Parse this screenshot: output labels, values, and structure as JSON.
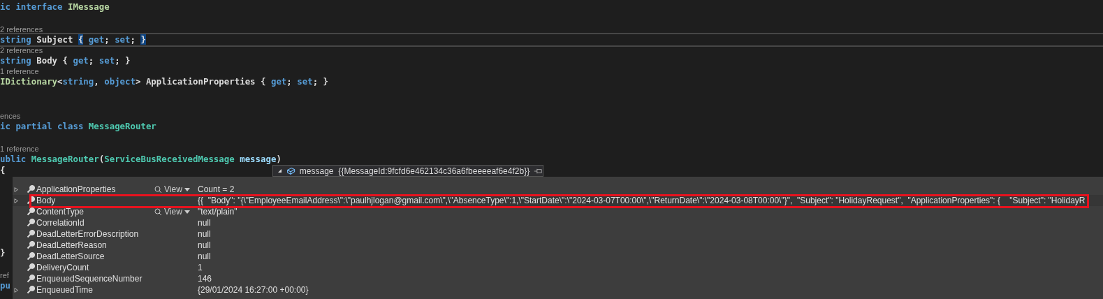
{
  "code_lines": [
    {
      "kind": "code",
      "current": false,
      "tokens": [
        {
          "text": "ic ",
          "kind": "keyword"
        },
        {
          "text": "interface ",
          "kind": "keyword"
        },
        {
          "text": "IMessage",
          "kind": "interface"
        }
      ]
    },
    {
      "kind": "blank"
    },
    {
      "kind": "lens",
      "text": "2 references"
    },
    {
      "kind": "code",
      "current": true,
      "tokens": [
        {
          "text": "string ",
          "kind": "keyword"
        },
        {
          "text": "Subject ",
          "kind": "plain"
        },
        {
          "text": "{",
          "kind": "match"
        },
        {
          "text": " get",
          "kind": "keyword"
        },
        {
          "text": "; ",
          "kind": "plain"
        },
        {
          "text": "set",
          "kind": "keyword"
        },
        {
          "text": "; ",
          "kind": "plain"
        },
        {
          "text": "}",
          "kind": "match"
        }
      ]
    },
    {
      "kind": "lens",
      "text": "2 references"
    },
    {
      "kind": "code",
      "current": false,
      "tokens": [
        {
          "text": "string ",
          "kind": "keyword"
        },
        {
          "text": "Body { ",
          "kind": "plain"
        },
        {
          "text": "get",
          "kind": "keyword"
        },
        {
          "text": "; ",
          "kind": "plain"
        },
        {
          "text": "set",
          "kind": "keyword"
        },
        {
          "text": "; }",
          "kind": "plain"
        }
      ]
    },
    {
      "kind": "lens",
      "text": "1 reference"
    },
    {
      "kind": "code",
      "current": false,
      "tokens": [
        {
          "text": "IDictionary",
          "kind": "interface"
        },
        {
          "text": "<",
          "kind": "plain"
        },
        {
          "text": "string",
          "kind": "keyword"
        },
        {
          "text": ", ",
          "kind": "plain"
        },
        {
          "text": "object",
          "kind": "keyword"
        },
        {
          "text": "> ApplicationProperties { ",
          "kind": "plain"
        },
        {
          "text": "get",
          "kind": "keyword"
        },
        {
          "text": "; ",
          "kind": "plain"
        },
        {
          "text": "set",
          "kind": "keyword"
        },
        {
          "text": "; }",
          "kind": "plain"
        }
      ]
    },
    {
      "kind": "blank"
    },
    {
      "kind": "blank"
    },
    {
      "kind": "lens",
      "text": "ences"
    },
    {
      "kind": "code",
      "current": false,
      "tokens": [
        {
          "text": "ic ",
          "kind": "keyword"
        },
        {
          "text": "partial ",
          "kind": "keyword"
        },
        {
          "text": "class ",
          "kind": "keyword"
        },
        {
          "text": "MessageRouter",
          "kind": "class"
        }
      ]
    },
    {
      "kind": "blank"
    },
    {
      "kind": "lens",
      "text": "1 reference"
    },
    {
      "kind": "code",
      "current": false,
      "tokens": [
        {
          "text": "ublic ",
          "kind": "keyword"
        },
        {
          "text": "MessageRouter",
          "kind": "class"
        },
        {
          "text": "(",
          "kind": "plain"
        },
        {
          "text": "ServiceBusReceivedMessage ",
          "kind": "class"
        },
        {
          "text": "message",
          "kind": "param"
        },
        {
          "text": ")",
          "kind": "plain"
        }
      ]
    },
    {
      "kind": "code",
      "current": false,
      "tokens": [
        {
          "text": "{",
          "kind": "plain"
        }
      ]
    },
    {
      "kind": "blank"
    },
    {
      "kind": "blank"
    },
    {
      "kind": "blank"
    },
    {
      "kind": "blank"
    },
    {
      "kind": "blank"
    },
    {
      "kind": "blank"
    },
    {
      "kind": "code",
      "current": false,
      "tokens": [
        {
          "text": "}",
          "kind": "plain"
        }
      ]
    },
    {
      "kind": "blank"
    },
    {
      "kind": "lens",
      "text": "ref"
    },
    {
      "kind": "code",
      "current": false,
      "tokens": [
        {
          "text": "pu",
          "kind": "keyword"
        }
      ]
    }
  ],
  "datatip": {
    "expanded": true,
    "name": "message",
    "value": "{{MessageId:9fcfd6e462134c36a6fbeeeeaf6e4f2b}}",
    "rows": [
      {
        "name": "ApplicationProperties",
        "expandable": true,
        "view": "View",
        "value": "Count = 2",
        "outlined": false
      },
      {
        "name": "Body",
        "expandable": true,
        "value": "{{  \"Body\": \"{\\\"EmployeeEmailAddress\\\":\\\"paulhjlogan@gmail.com\\\",\\\"AbsenceType\\\":1,\\\"StartDate\\\":\\\"2024-03-07T00:00\\\",\\\"ReturnDate\\\":\\\"2024-03-08T00:00\\\"}\",  \"Subject\": \"HolidayRequest\",  \"ApplicationProperties\": {    \"Subject\": \"HolidayR",
        "outlined": true
      },
      {
        "name": "ContentType",
        "expandable": false,
        "view": "View",
        "value": "\"text/plain\"",
        "outlined": false
      },
      {
        "name": "CorrelationId",
        "expandable": false,
        "value": "null",
        "outlined": false
      },
      {
        "name": "DeadLetterErrorDescription",
        "expandable": false,
        "value": "null",
        "outlined": false
      },
      {
        "name": "DeadLetterReason",
        "expandable": false,
        "value": "null",
        "outlined": false
      },
      {
        "name": "DeadLetterSource",
        "expandable": false,
        "value": "null",
        "outlined": false
      },
      {
        "name": "DeliveryCount",
        "expandable": false,
        "value": "1",
        "outlined": false
      },
      {
        "name": "EnqueuedSequenceNumber",
        "expandable": false,
        "value": "146",
        "outlined": false
      },
      {
        "name": "EnqueuedTime",
        "expandable": true,
        "value": "{29/01/2024 16:27:00 +00:00}",
        "outlined": false
      }
    ]
  }
}
